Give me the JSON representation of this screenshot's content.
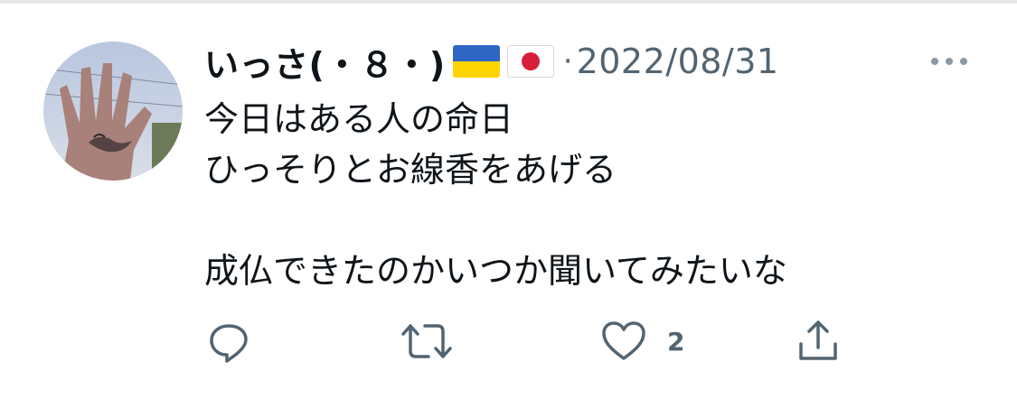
{
  "tweet": {
    "display_name": "いっさ(・８・)",
    "flags": [
      "ukraine-flag-icon",
      "japan-flag-icon"
    ],
    "separator": "·",
    "timestamp": "2022/08/31",
    "text_lines": [
      "今日はある人の命日",
      "ひっそりとお線香をあげる",
      "",
      "成仏できたのかいつか聞いてみたいな"
    ]
  },
  "actions": {
    "reply_icon": "reply-icon",
    "retweet_icon": "retweet-icon",
    "like_icon": "heart-icon",
    "like_count": "2",
    "share_icon": "share-icon"
  },
  "colors": {
    "text_primary": "#0f1419",
    "text_secondary": "#536471",
    "icon_gray": "#536471",
    "divider": "#e7e9ea",
    "ukraine_blue": "#2f66c4",
    "ukraine_yellow": "#ffd500",
    "japan_red": "#d6203a"
  }
}
